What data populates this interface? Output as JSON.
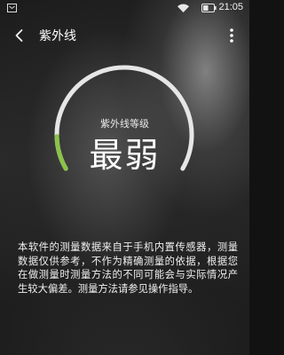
{
  "status_bar": {
    "time": "21:05",
    "left_icon": "notification-icon",
    "wifi_icon": "wifi-icon",
    "battery_icon": "battery-icon",
    "battery_level": 0.5
  },
  "app_bar": {
    "title": "紫外线",
    "back_icon": "back-arrow-icon",
    "menu_icon": "more-vert-icon"
  },
  "gauge": {
    "label": "紫外线等级",
    "value": "最弱",
    "level": 0.12,
    "colors": {
      "track": "#e6e6e6",
      "fill": "#8bc34a"
    }
  },
  "disclaimer": "本软件的测量数据来自于手机内置传感器，测量数据仅供参考，不作为精确测量的依据，根据您在做测量时测量方法的不同可能会与实际情况产生较大偏差。测量方法请参见操作指导。"
}
